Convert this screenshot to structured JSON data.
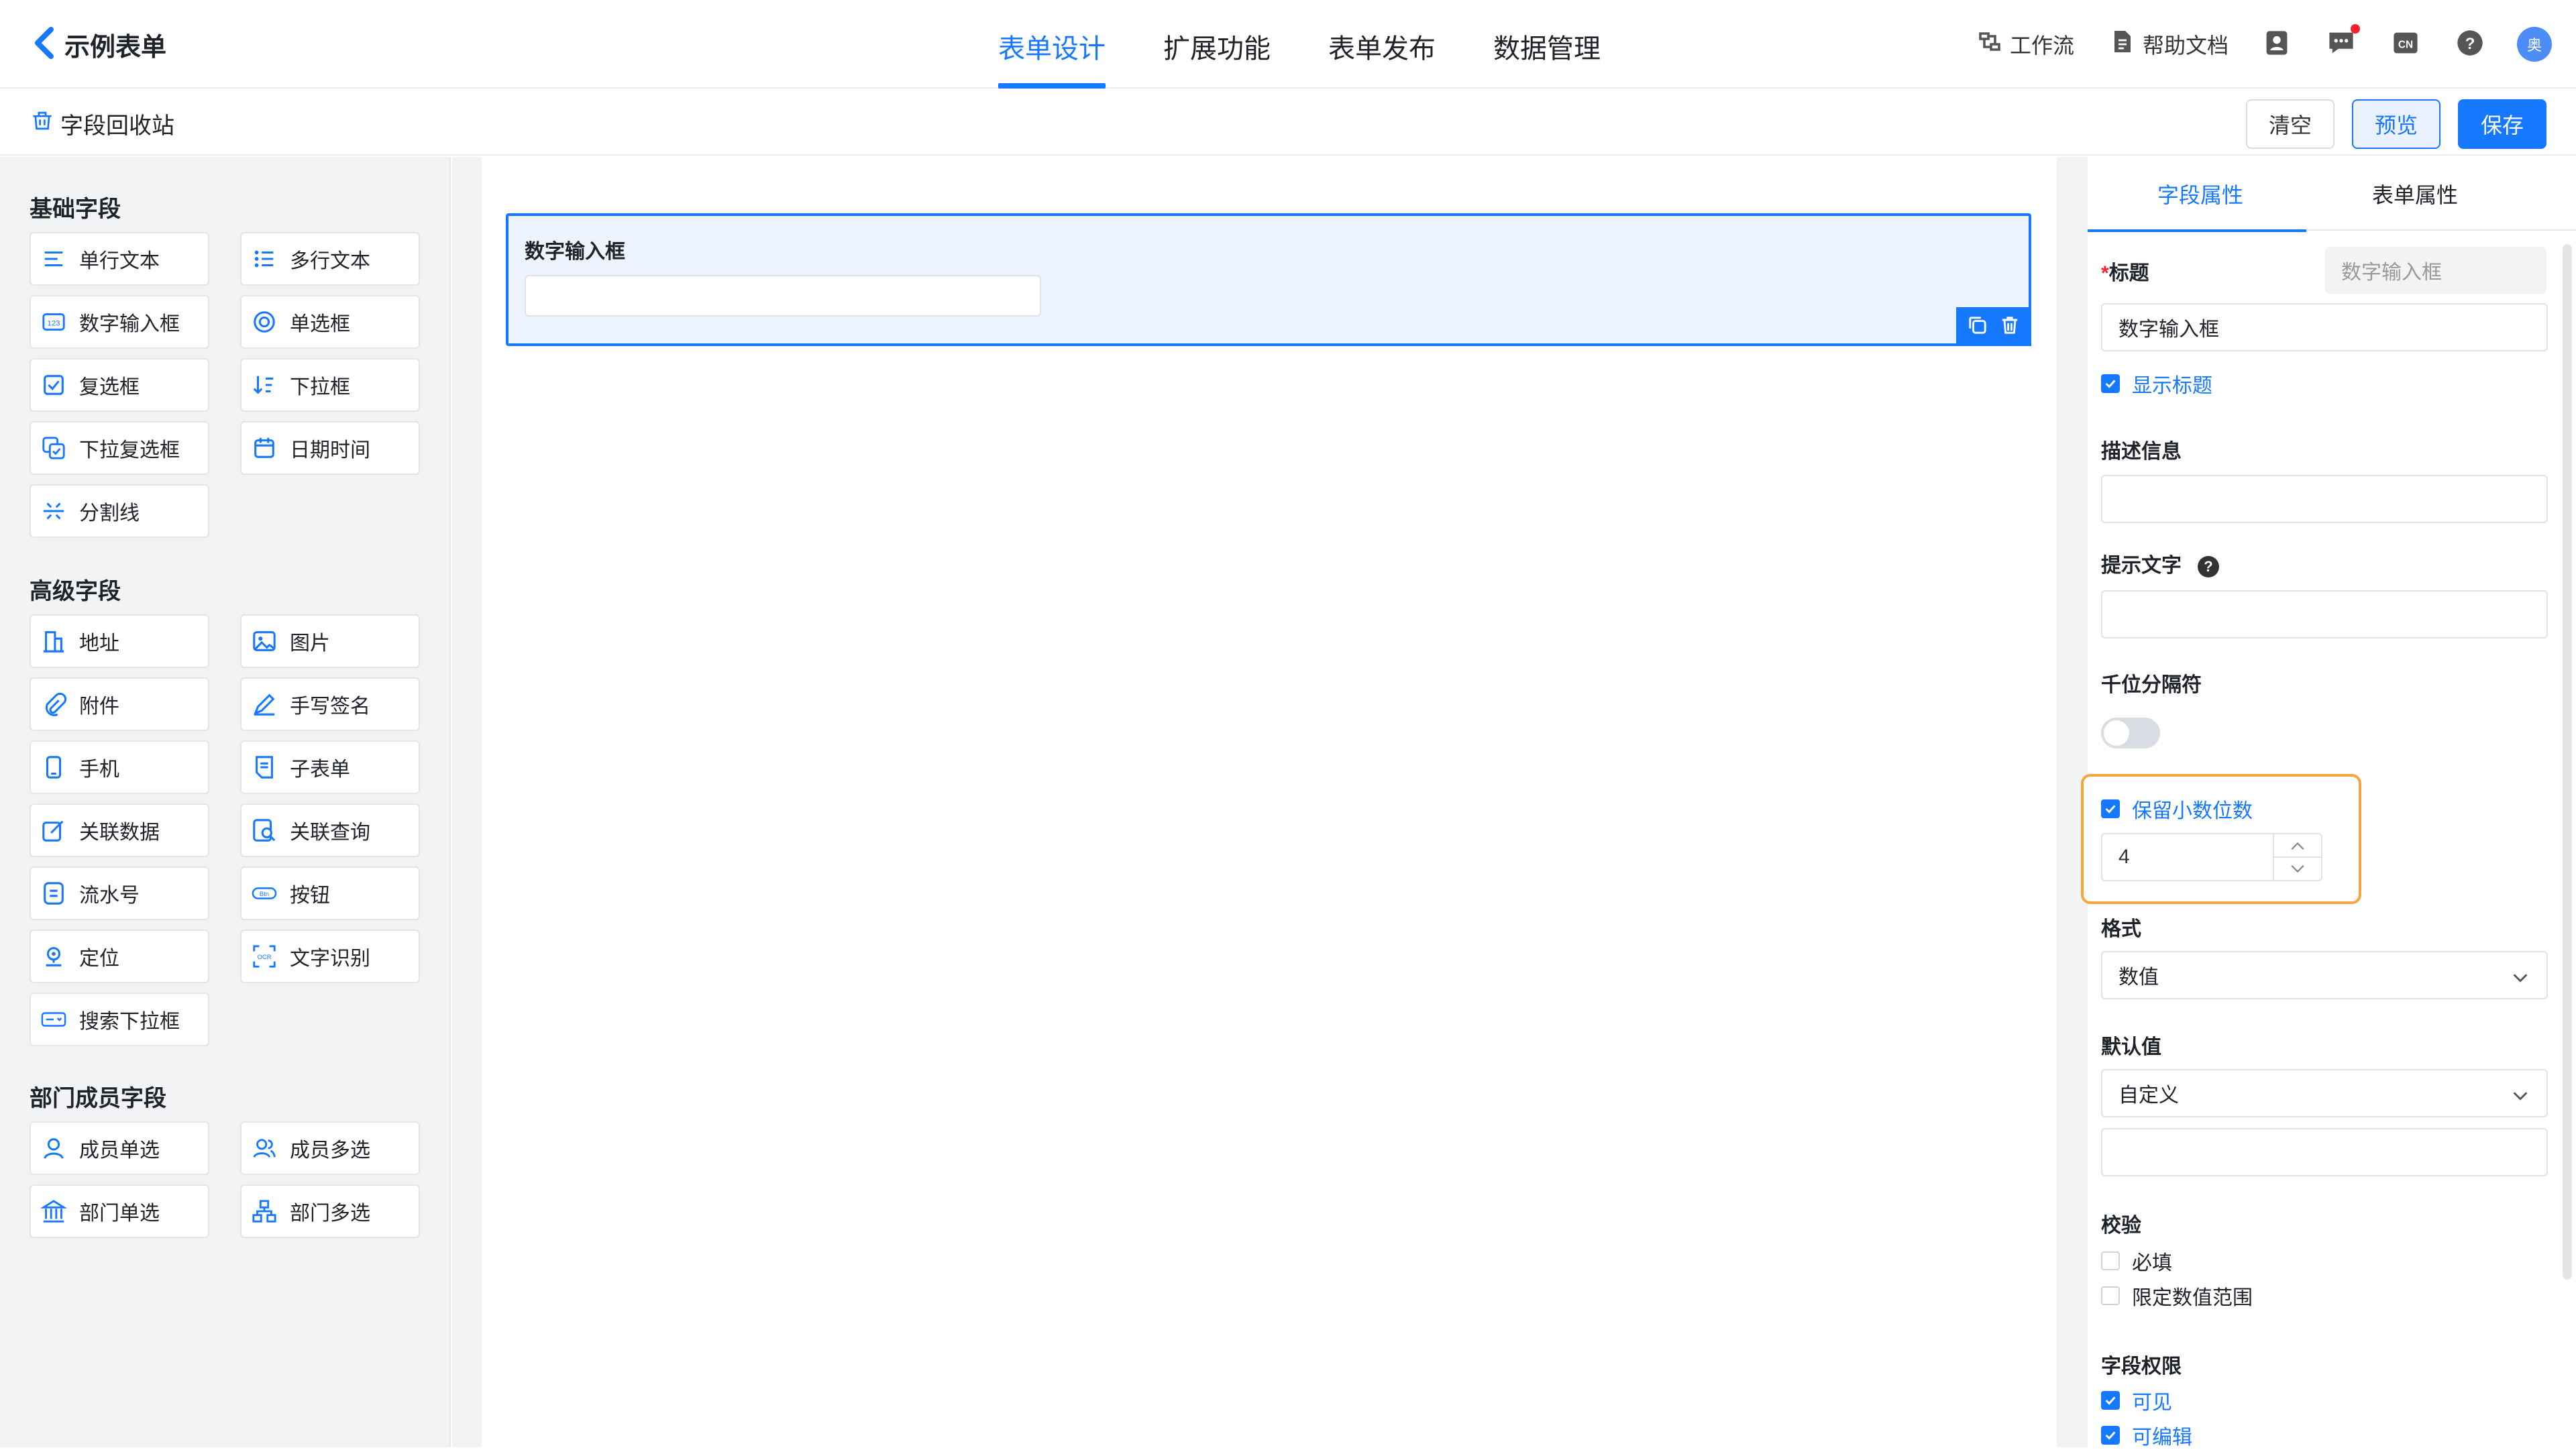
{
  "header": {
    "title": "示例表单",
    "tabs": [
      {
        "label": "表单设计",
        "active": true
      },
      {
        "label": "扩展功能",
        "active": false
      },
      {
        "label": "表单发布",
        "active": false
      },
      {
        "label": "数据管理",
        "active": false
      }
    ],
    "workflow_label": "工作流",
    "help_label": "帮助文档",
    "avatar_text": "奥"
  },
  "toolbar": {
    "recycle_label": "字段回收站",
    "clear_label": "清空",
    "preview_label": "预览",
    "save_label": "保存"
  },
  "left_panel": {
    "basic_title": "基础字段",
    "basic_fields": [
      "单行文本",
      "多行文本",
      "数字输入框",
      "单选框",
      "复选框",
      "下拉框",
      "下拉复选框",
      "日期时间",
      "分割线"
    ],
    "advanced_title": "高级字段",
    "advanced_fields": [
      "地址",
      "图片",
      "附件",
      "手写签名",
      "手机",
      "子表单",
      "关联数据",
      "关联查询",
      "流水号",
      "按钮",
      "定位",
      "文字识别",
      "搜索下拉框"
    ],
    "dept_title": "部门成员字段",
    "dept_fields": [
      "成员单选",
      "成员多选",
      "部门单选",
      "部门多选"
    ]
  },
  "canvas": {
    "selected_field_label": "数字输入框"
  },
  "properties": {
    "tab_field": "字段属性",
    "tab_form": "表单属性",
    "title_label": "标题",
    "title_required_mark": "*",
    "title_type_placeholder": "数字输入框",
    "title_value": "数字输入框",
    "show_title_label": "显示标题",
    "show_title_checked": true,
    "description_label": "描述信息",
    "hint_label": "提示文字",
    "hint_help": "?",
    "thousands_label": "千位分隔符",
    "thousands_on": false,
    "keep_decimal_label": "保留小数位数",
    "keep_decimal_checked": true,
    "decimal_value": "4",
    "format_label": "格式",
    "format_value": "数值",
    "default_label": "默认值",
    "default_mode": "自定义",
    "validate_label": "校验",
    "required_label": "必填",
    "required_checked": false,
    "range_label": "限定数值范围",
    "range_checked": false,
    "permission_label": "字段权限",
    "visible_label": "可见",
    "visible_checked": true,
    "editable_label": "可编辑"
  },
  "colors": {
    "accent": "#1677ff",
    "highlight_border": "#f5a63d",
    "panel_bg": "#f2f3f5",
    "required": "#f5222d"
  }
}
